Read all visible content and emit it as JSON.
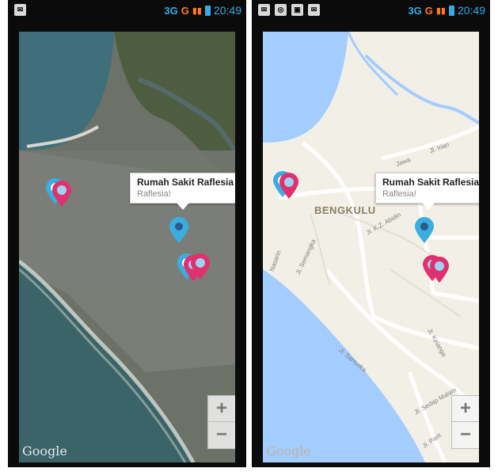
{
  "status_bar": {
    "time": "20:49",
    "network_a": "3G",
    "network_b": "G"
  },
  "left_panel": {
    "map_type": "satellite",
    "info_window": {
      "title": "Rumah Sakit Raflesia",
      "subtitle": "Raflesia!"
    },
    "zoom_in": "+",
    "zoom_out": "−",
    "attribution": "Google"
  },
  "right_panel": {
    "map_type": "roadmap",
    "info_window": {
      "title": "Rumah Sakit Raflesia",
      "subtitle": "Raflesia!"
    },
    "city_label": "BENGKULU",
    "street_labels": {
      "irian": "Jl. Irian",
      "jawa": "Jawa",
      "kz_abidin": "Jl. K.Z. Abidin",
      "semangka": "Jl. Semangka",
      "nasarin": "Nasarin",
      "kinanga": "Jl. Kinanga",
      "samudra": "Jl. Samudra",
      "sedap_malam": "Jl. Sedap Malam",
      "parit": "Jl. Parit"
    },
    "zoom_in": "+",
    "zoom_out": "−",
    "attribution": "Google"
  },
  "colors": {
    "status_accent": "#39a9e6",
    "pin_pink": "#e0306e",
    "pin_blue": "#3aaee0",
    "water_road_map": "#a3ccff",
    "land_road_map": "#f2efe6"
  },
  "icons": [
    "message-icon",
    "instagram-icon",
    "gallery-icon",
    "signal-icon",
    "battery-icon",
    "hospital-pin-icon",
    "user-location-pin-icon"
  ]
}
